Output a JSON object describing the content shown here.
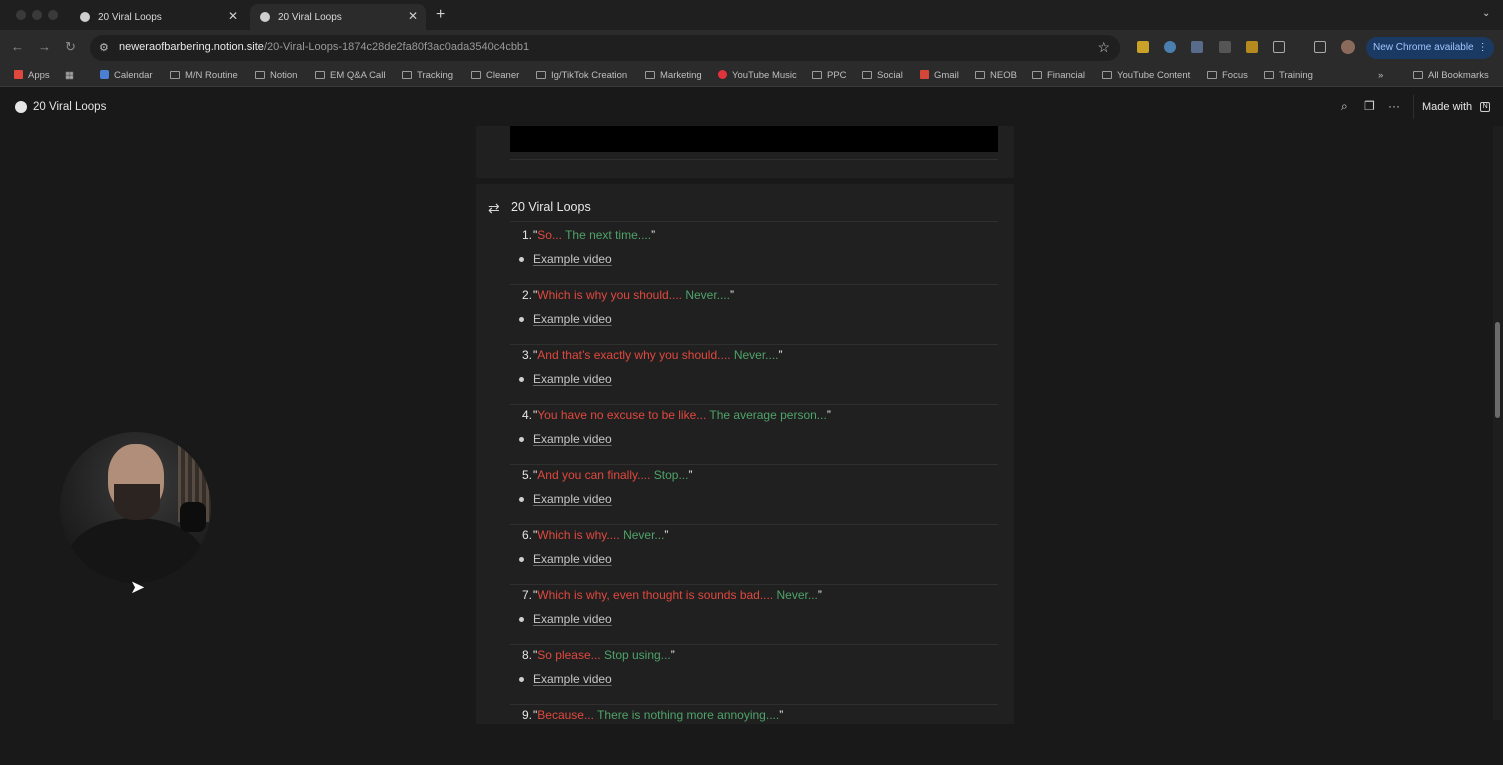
{
  "browser": {
    "tabs": [
      {
        "label": "20 Viral Loops",
        "active": false
      },
      {
        "label": "20 Viral Loops",
        "active": true
      }
    ],
    "url_domain": "neweraofbarbering.notion.site",
    "url_path": "/20-Viral-Loops-1874c28de2fa80f3ac0ada3540c4cbb1",
    "new_chrome_label": "New Chrome available",
    "bookmarks": [
      "Apps",
      "Calendar",
      "M/N Routine",
      "Notion",
      "EM Q&A Call",
      "Tracking",
      "Cleaner",
      "Ig/TikTok Creation",
      "Marketing",
      "YouTube Music",
      "PPC",
      "Social",
      "Gmail",
      "NEOB",
      "Financial",
      "YouTube Content",
      "Focus",
      "Training"
    ],
    "all_bookmarks": "All Bookmarks"
  },
  "notion": {
    "page_title": "20 Viral Loops",
    "made_with": "Made with"
  },
  "content": {
    "heading": "20 Viral Loops",
    "example_label": "Example video",
    "items": [
      {
        "num": "1.",
        "red": "So...",
        "green": " The next time....",
        "close": "”"
      },
      {
        "num": "2.",
        "red": "Which is why you should....",
        "green": " Never....",
        "close": "”"
      },
      {
        "num": "3.",
        "red": "And that’s exactly why you should....",
        "green": " Never....",
        "close": "”"
      },
      {
        "num": "4.",
        "red": "You have no excuse to be like...",
        "green": " The average person...",
        "close": "”"
      },
      {
        "num": "5.",
        "red": "And you can finally....",
        "green": " Stop...",
        "close": "”"
      },
      {
        "num": "6.",
        "red": "Which is why....",
        "green": " Never...",
        "close": "”"
      },
      {
        "num": "7.",
        "red": "Which is why, even thought is sounds bad....",
        "green": " Never...",
        "close": "”"
      },
      {
        "num": "8.",
        "red": "So please...",
        "green": " Stop using...",
        "close": "”"
      },
      {
        "num": "9.",
        "red": "Because...",
        "green": " There is nothing more annoying....",
        "close": "”"
      }
    ]
  },
  "colors": {
    "red_text": "#e0483e",
    "green_text": "#4fa36a",
    "background": "#191919",
    "card": "#202020"
  }
}
